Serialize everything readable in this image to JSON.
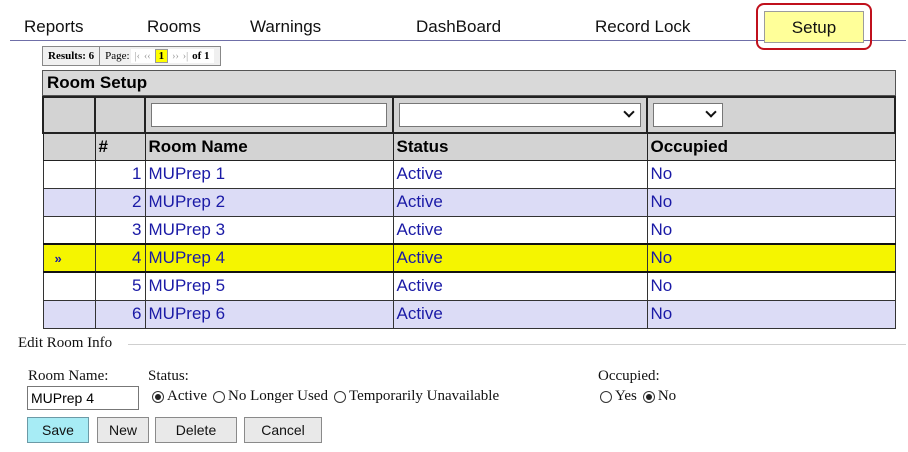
{
  "nav": {
    "items": [
      "Reports",
      "Rooms",
      "Warnings",
      "DashBoard",
      "Record Lock"
    ],
    "active": "Setup"
  },
  "pager": {
    "results_label": "Results:",
    "results_count": "6",
    "page_label": "Page:",
    "first": "|‹",
    "prev": "‹‹",
    "current": "1",
    "next": "››",
    "last": "›|",
    "of": "of 1"
  },
  "grid": {
    "title": "Room Setup",
    "columns": [
      "",
      "#",
      "Room Name",
      "Status",
      "Occupied"
    ],
    "selected_marker": "»",
    "rows": [
      {
        "num": "1",
        "name": "MUPrep 1",
        "status": "Active",
        "occupied": "No"
      },
      {
        "num": "2",
        "name": "MUPrep 2",
        "status": "Active",
        "occupied": "No"
      },
      {
        "num": "3",
        "name": "MUPrep 3",
        "status": "Active",
        "occupied": "No"
      },
      {
        "num": "4",
        "name": "MUPrep 4",
        "status": "Active",
        "occupied": "No"
      },
      {
        "num": "5",
        "name": "MUPrep 5",
        "status": "Active",
        "occupied": "No"
      },
      {
        "num": "6",
        "name": "MUPrep 6",
        "status": "Active",
        "occupied": "No"
      }
    ],
    "selected_index": 3
  },
  "edit": {
    "legend": "Edit Room Info",
    "room_name_label": "Room Name:",
    "room_name_value": "MUPrep 4",
    "status_label": "Status:",
    "status_options": [
      "Active",
      "No Longer Used",
      "Temporarily Unavailable"
    ],
    "status_selected": "Active",
    "occupied_label": "Occupied:",
    "occupied_options": [
      "Yes",
      "No"
    ],
    "occupied_selected": "No",
    "buttons": {
      "save": "Save",
      "new": "New",
      "delete": "Delete",
      "cancel": "Cancel"
    }
  },
  "colors": {
    "selected_row": "#f5f500",
    "even_row": "#dcdcf6",
    "link_text": "#1a1aa6",
    "setup_tab": "#ffff99",
    "setup_highlight": "#c0101c",
    "save_button": "#a7ecf5"
  }
}
